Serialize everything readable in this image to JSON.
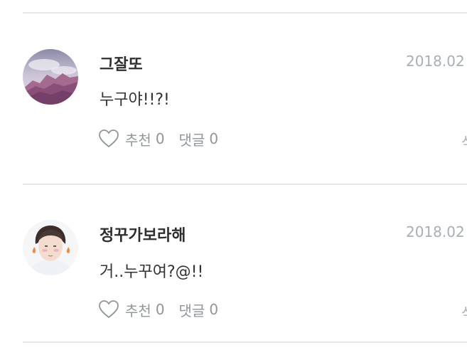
{
  "comments": [
    {
      "author": "그잘또",
      "date": "2018.02",
      "text": "누구야!!?!",
      "like_label": "추천",
      "like_count": "0",
      "comment_label": "댓글",
      "comment_count": "0",
      "cut_action": "삭"
    },
    {
      "author": "정꾸가보라해",
      "date": "2018.02",
      "text": "거..누꾸여?@!!",
      "like_label": "추천",
      "like_count": "0",
      "comment_label": "댓글",
      "comment_count": "0",
      "cut_action": "삭"
    }
  ]
}
